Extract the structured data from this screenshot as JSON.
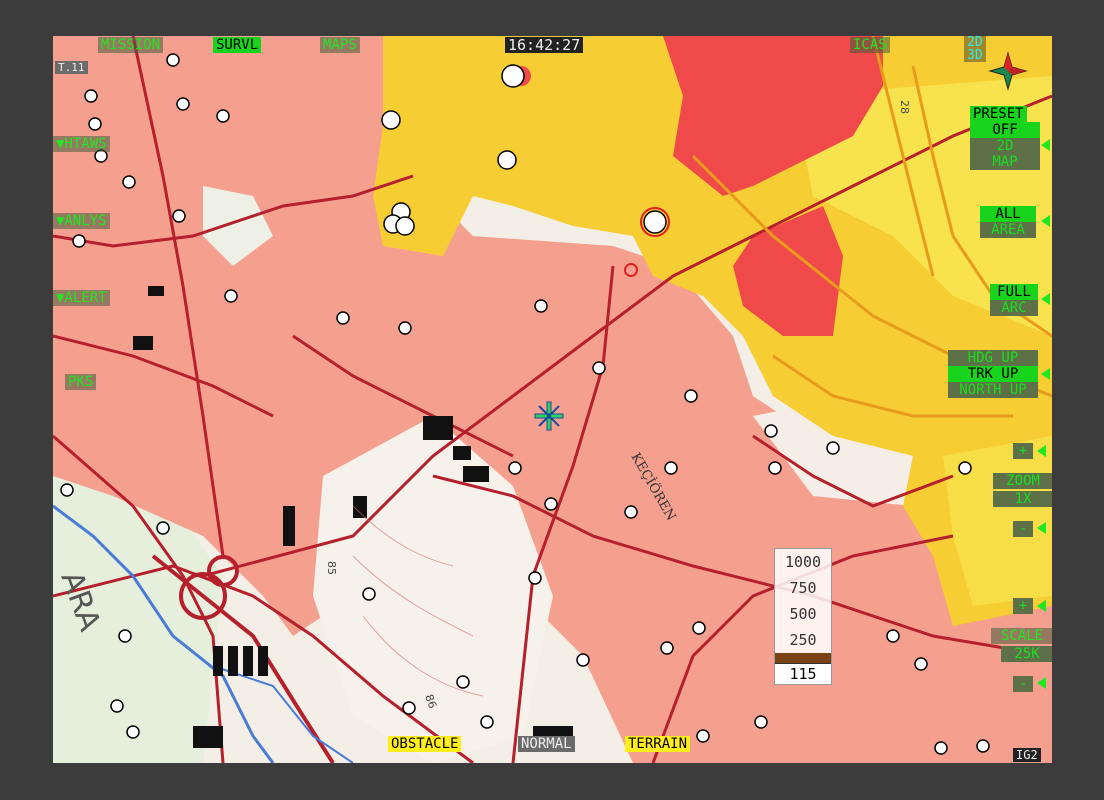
{
  "top_bar": {
    "mission": "MISSION",
    "survl": "SURVL",
    "maps": "MAPS",
    "clock": "16:42:27",
    "icas": "ICAS",
    "mode_2d": "2D",
    "mode_3d": "3D"
  },
  "left_panel": {
    "page_tag": "T.11",
    "htaws": "▼HTAWS",
    "anlys": "▼ANLYS",
    "alert": "▼ALERT",
    "pks": "PKS"
  },
  "right_panel": {
    "preset": "PRESET",
    "preset_value": "OFF",
    "preset_2d": "2D",
    "preset_map": "MAP",
    "all": "ALL",
    "area": "AREA",
    "full": "FULL",
    "arc": "ARC",
    "hdg_up": "HDG UP",
    "trk_up": "TRK UP",
    "north_up": "NORTH UP",
    "zoom_plus": "+",
    "zoom_label": "ZOOM",
    "zoom_value": "1X",
    "zoom_minus": "-",
    "scale_plus": "+",
    "scale_label": "SCALE",
    "scale_value": "25K",
    "scale_minus": "-"
  },
  "bottom_bar": {
    "obstacle": "OBSTACLE",
    "normal": "NORMAL",
    "terrain": "TERRAIN",
    "page_id": "IG2"
  },
  "legend": {
    "values": [
      "1000",
      "750",
      "500",
      "250"
    ],
    "base_value": "115"
  },
  "map_labels": {
    "district": "KEÇİÖREN",
    "city_fragment": "ARA",
    "spot_85": "85",
    "spot_86": "86",
    "route_28": "28"
  },
  "colors": {
    "terrain_red": "#ef4949",
    "terrain_yellow": "#f7cd34",
    "urban_salmon": "#f5a08f",
    "road": "#b5202c",
    "hud_green": "#19d41c"
  }
}
